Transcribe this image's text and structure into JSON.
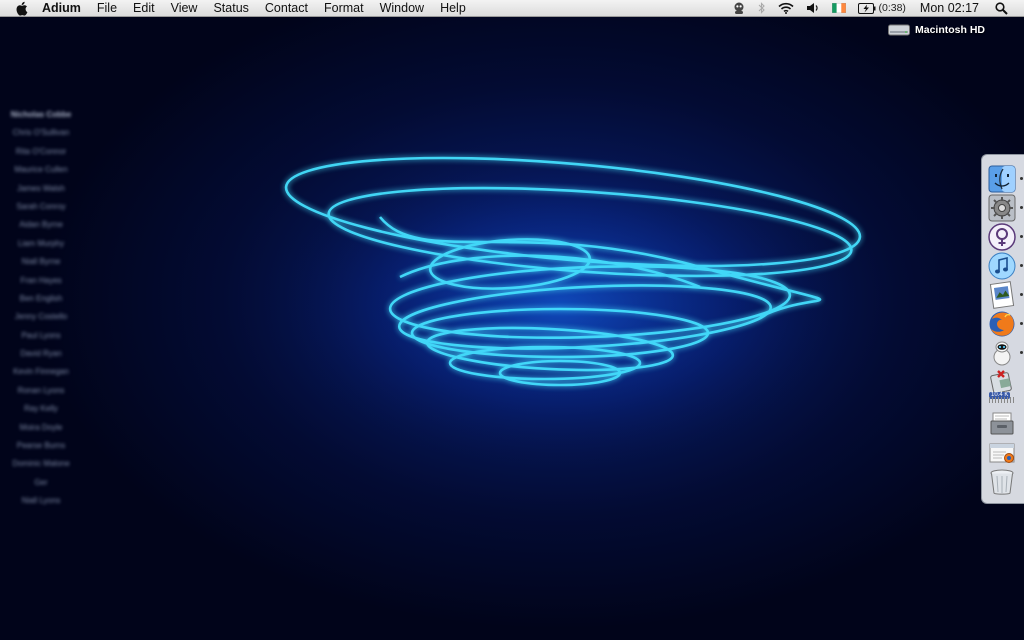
{
  "menubar": {
    "app_name": "Adium",
    "menus": [
      "File",
      "Edit",
      "View",
      "Status",
      "Contact",
      "Format",
      "Window",
      "Help"
    ],
    "battery_time": "(0:38)",
    "clock": "Mon 02:17"
  },
  "desktop": {
    "drive_label": "Macintosh HD"
  },
  "contact_list": {
    "header": "Nicholas Cobbe",
    "contacts": [
      "Chris O'Sullivan",
      "Rita O'Connor",
      "Maurice Cullen",
      "James Walsh",
      "Sarah Conroy",
      "Aidan Byrne",
      "Liam Murphy",
      "Niall Byrne",
      "Fran Hayes",
      "Ben English",
      "Jenny Costello",
      "Paul Lyons",
      "David Ryan",
      "Kevin Finnegan",
      "Ronan Lyons",
      "Ray Kelly",
      "Moira Doyle",
      "Pearse Burns",
      "Dominic Malone",
      "Ger",
      "Niall Lyons"
    ]
  },
  "dock": {
    "items": [
      {
        "name": "finder-icon",
        "running": true
      },
      {
        "name": "system-preferences-icon",
        "running": true
      },
      {
        "name": "adium-icon",
        "running": true
      },
      {
        "name": "itunes-icon",
        "running": true
      },
      {
        "name": "preview-icon",
        "running": true
      },
      {
        "name": "firefox-icon",
        "running": true
      },
      {
        "name": "robot-app-icon",
        "running": true
      },
      {
        "name": "download-manager-icon",
        "running": false,
        "badge": "10.4 K"
      },
      {
        "name": "documents-stack-icon",
        "running": false
      },
      {
        "name": "downloads-stack-icon",
        "running": false
      },
      {
        "name": "trash-icon",
        "running": false
      }
    ]
  },
  "colors": {
    "glow": "#39d7ff",
    "background_dark": "#01041a",
    "background_mid": "#061757"
  }
}
